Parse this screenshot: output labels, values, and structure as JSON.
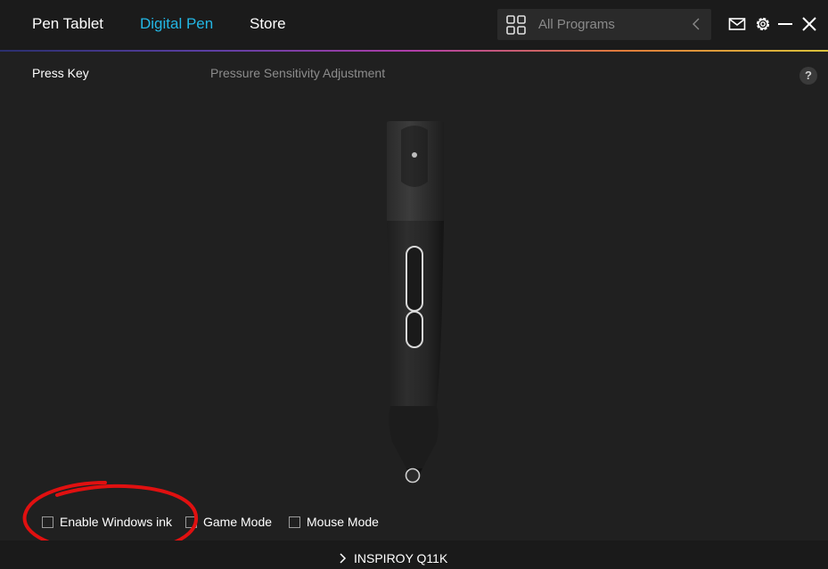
{
  "header": {
    "tabs": [
      {
        "label": "Pen Tablet",
        "active": false
      },
      {
        "label": "Digital Pen",
        "active": true
      },
      {
        "label": "Store",
        "active": false
      }
    ],
    "program_selector": {
      "label": "All Programs",
      "icon": "grid-icon",
      "arrow_icon": "chevron-left-icon"
    },
    "window_icons": [
      "mail-icon",
      "gear-icon",
      "minimize-icon",
      "close-icon"
    ],
    "accent_color": "#23b7e5"
  },
  "subtabs": [
    {
      "label": "Press Key",
      "active": true
    },
    {
      "label": "Pressure Sensitivity Adjustment",
      "active": false
    }
  ],
  "help_label": "?",
  "options": [
    {
      "label": "Enable Windows ink",
      "checked": false
    },
    {
      "label": "Game Mode",
      "checked": false
    },
    {
      "label": "Mouse Mode",
      "checked": false
    }
  ],
  "footer": {
    "device_name": "INSPIROY Q11K",
    "icon": "chevron-right-icon"
  },
  "annotation": {
    "color": "#e01010",
    "shape": "hand-drawn circle around Enable Windows ink"
  }
}
